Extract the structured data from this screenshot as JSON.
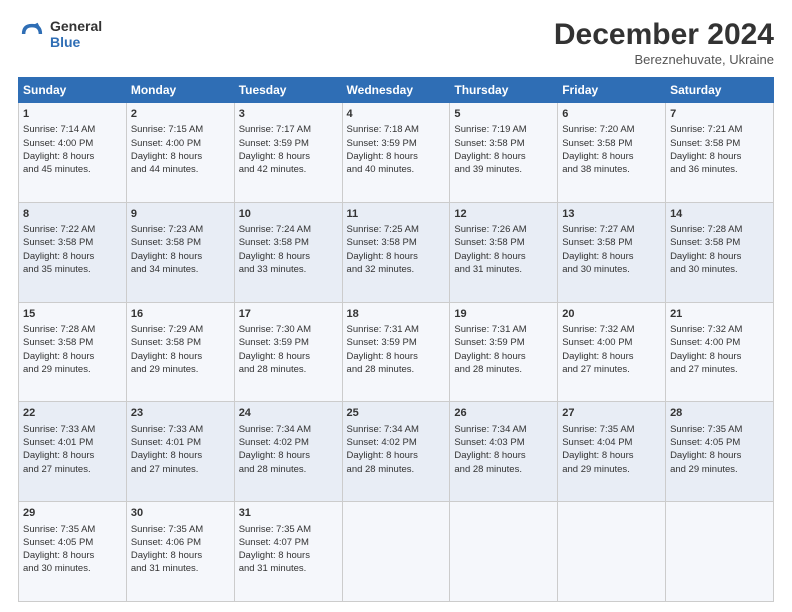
{
  "header": {
    "logo_line1": "General",
    "logo_line2": "Blue",
    "title": "December 2024",
    "subtitle": "Bereznehuvate, Ukraine"
  },
  "columns": [
    "Sunday",
    "Monday",
    "Tuesday",
    "Wednesday",
    "Thursday",
    "Friday",
    "Saturday"
  ],
  "weeks": [
    [
      {
        "day": "1",
        "lines": [
          "Sunrise: 7:14 AM",
          "Sunset: 4:00 PM",
          "Daylight: 8 hours",
          "and 45 minutes."
        ]
      },
      {
        "day": "2",
        "lines": [
          "Sunrise: 7:15 AM",
          "Sunset: 4:00 PM",
          "Daylight: 8 hours",
          "and 44 minutes."
        ]
      },
      {
        "day": "3",
        "lines": [
          "Sunrise: 7:17 AM",
          "Sunset: 3:59 PM",
          "Daylight: 8 hours",
          "and 42 minutes."
        ]
      },
      {
        "day": "4",
        "lines": [
          "Sunrise: 7:18 AM",
          "Sunset: 3:59 PM",
          "Daylight: 8 hours",
          "and 40 minutes."
        ]
      },
      {
        "day": "5",
        "lines": [
          "Sunrise: 7:19 AM",
          "Sunset: 3:58 PM",
          "Daylight: 8 hours",
          "and 39 minutes."
        ]
      },
      {
        "day": "6",
        "lines": [
          "Sunrise: 7:20 AM",
          "Sunset: 3:58 PM",
          "Daylight: 8 hours",
          "and 38 minutes."
        ]
      },
      {
        "day": "7",
        "lines": [
          "Sunrise: 7:21 AM",
          "Sunset: 3:58 PM",
          "Daylight: 8 hours",
          "and 36 minutes."
        ]
      }
    ],
    [
      {
        "day": "8",
        "lines": [
          "Sunrise: 7:22 AM",
          "Sunset: 3:58 PM",
          "Daylight: 8 hours",
          "and 35 minutes."
        ]
      },
      {
        "day": "9",
        "lines": [
          "Sunrise: 7:23 AM",
          "Sunset: 3:58 PM",
          "Daylight: 8 hours",
          "and 34 minutes."
        ]
      },
      {
        "day": "10",
        "lines": [
          "Sunrise: 7:24 AM",
          "Sunset: 3:58 PM",
          "Daylight: 8 hours",
          "and 33 minutes."
        ]
      },
      {
        "day": "11",
        "lines": [
          "Sunrise: 7:25 AM",
          "Sunset: 3:58 PM",
          "Daylight: 8 hours",
          "and 32 minutes."
        ]
      },
      {
        "day": "12",
        "lines": [
          "Sunrise: 7:26 AM",
          "Sunset: 3:58 PM",
          "Daylight: 8 hours",
          "and 31 minutes."
        ]
      },
      {
        "day": "13",
        "lines": [
          "Sunrise: 7:27 AM",
          "Sunset: 3:58 PM",
          "Daylight: 8 hours",
          "and 30 minutes."
        ]
      },
      {
        "day": "14",
        "lines": [
          "Sunrise: 7:28 AM",
          "Sunset: 3:58 PM",
          "Daylight: 8 hours",
          "and 30 minutes."
        ]
      }
    ],
    [
      {
        "day": "15",
        "lines": [
          "Sunrise: 7:28 AM",
          "Sunset: 3:58 PM",
          "Daylight: 8 hours",
          "and 29 minutes."
        ]
      },
      {
        "day": "16",
        "lines": [
          "Sunrise: 7:29 AM",
          "Sunset: 3:58 PM",
          "Daylight: 8 hours",
          "and 29 minutes."
        ]
      },
      {
        "day": "17",
        "lines": [
          "Sunrise: 7:30 AM",
          "Sunset: 3:59 PM",
          "Daylight: 8 hours",
          "and 28 minutes."
        ]
      },
      {
        "day": "18",
        "lines": [
          "Sunrise: 7:31 AM",
          "Sunset: 3:59 PM",
          "Daylight: 8 hours",
          "and 28 minutes."
        ]
      },
      {
        "day": "19",
        "lines": [
          "Sunrise: 7:31 AM",
          "Sunset: 3:59 PM",
          "Daylight: 8 hours",
          "and 28 minutes."
        ]
      },
      {
        "day": "20",
        "lines": [
          "Sunrise: 7:32 AM",
          "Sunset: 4:00 PM",
          "Daylight: 8 hours",
          "and 27 minutes."
        ]
      },
      {
        "day": "21",
        "lines": [
          "Sunrise: 7:32 AM",
          "Sunset: 4:00 PM",
          "Daylight: 8 hours",
          "and 27 minutes."
        ]
      }
    ],
    [
      {
        "day": "22",
        "lines": [
          "Sunrise: 7:33 AM",
          "Sunset: 4:01 PM",
          "Daylight: 8 hours",
          "and 27 minutes."
        ]
      },
      {
        "day": "23",
        "lines": [
          "Sunrise: 7:33 AM",
          "Sunset: 4:01 PM",
          "Daylight: 8 hours",
          "and 27 minutes."
        ]
      },
      {
        "day": "24",
        "lines": [
          "Sunrise: 7:34 AM",
          "Sunset: 4:02 PM",
          "Daylight: 8 hours",
          "and 28 minutes."
        ]
      },
      {
        "day": "25",
        "lines": [
          "Sunrise: 7:34 AM",
          "Sunset: 4:02 PM",
          "Daylight: 8 hours",
          "and 28 minutes."
        ]
      },
      {
        "day": "26",
        "lines": [
          "Sunrise: 7:34 AM",
          "Sunset: 4:03 PM",
          "Daylight: 8 hours",
          "and 28 minutes."
        ]
      },
      {
        "day": "27",
        "lines": [
          "Sunrise: 7:35 AM",
          "Sunset: 4:04 PM",
          "Daylight: 8 hours",
          "and 29 minutes."
        ]
      },
      {
        "day": "28",
        "lines": [
          "Sunrise: 7:35 AM",
          "Sunset: 4:05 PM",
          "Daylight: 8 hours",
          "and 29 minutes."
        ]
      }
    ],
    [
      {
        "day": "29",
        "lines": [
          "Sunrise: 7:35 AM",
          "Sunset: 4:05 PM",
          "Daylight: 8 hours",
          "and 30 minutes."
        ]
      },
      {
        "day": "30",
        "lines": [
          "Sunrise: 7:35 AM",
          "Sunset: 4:06 PM",
          "Daylight: 8 hours",
          "and 31 minutes."
        ]
      },
      {
        "day": "31",
        "lines": [
          "Sunrise: 7:35 AM",
          "Sunset: 4:07 PM",
          "Daylight: 8 hours",
          "and 31 minutes."
        ]
      },
      null,
      null,
      null,
      null
    ]
  ]
}
